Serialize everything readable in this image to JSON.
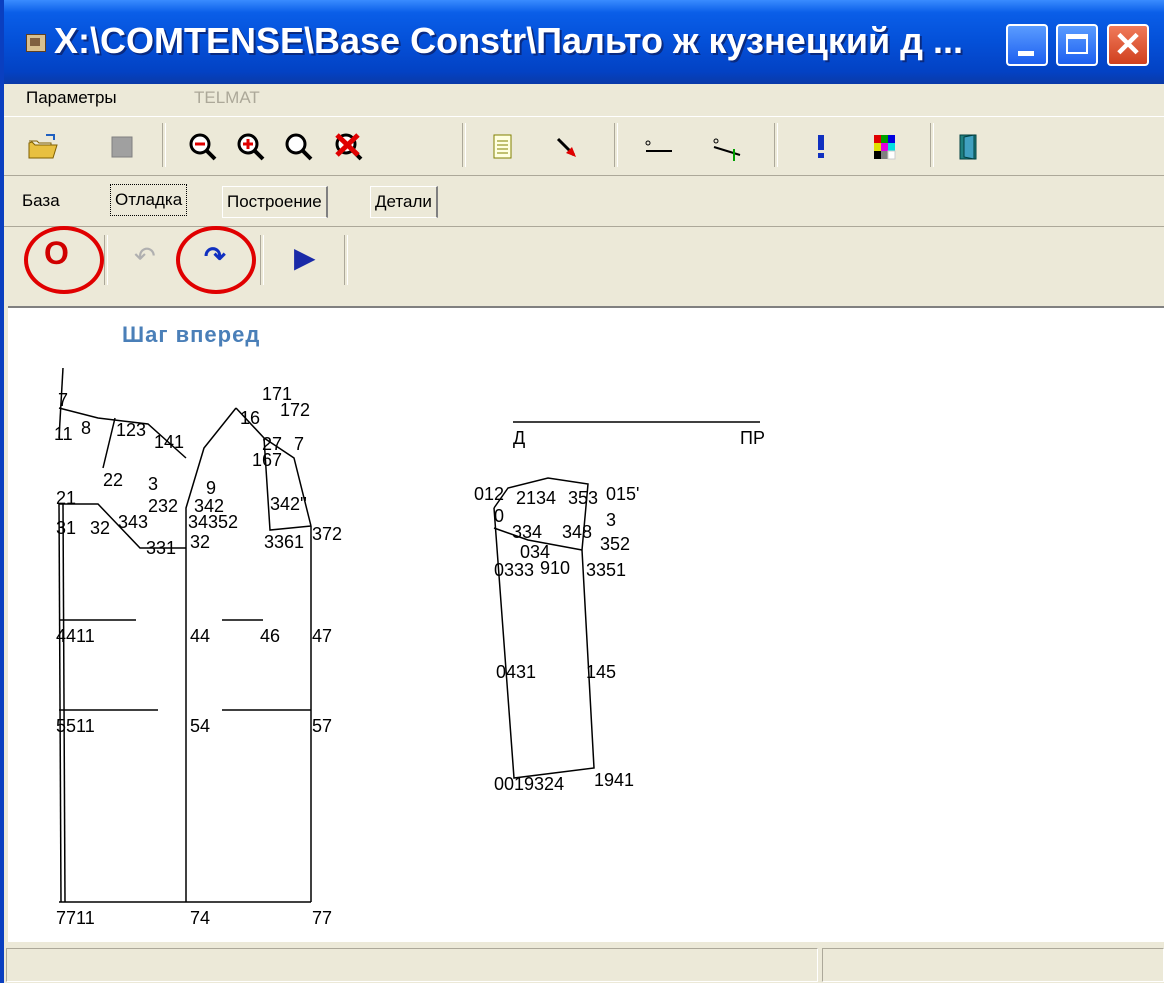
{
  "window": {
    "title": "X:\\COMTENSE\\Base Constr\\Пальто ж кузнецкий д ...",
    "minimize_glyph": "_",
    "maximize_glyph": "□",
    "close_glyph": "✕"
  },
  "menu": {
    "items": [
      "Параметры",
      "TELMAT"
    ]
  },
  "toolbar": {
    "icons": [
      "open-folder-icon",
      "stop-icon",
      "zoom-out-icon",
      "zoom-in-icon",
      "zoom-icon",
      "zoom-cancel-icon",
      "document-icon",
      "pointer-icon",
      "measure-line-icon",
      "measure-angle-icon",
      "info-icon",
      "color-palette-icon",
      "exit-icon"
    ]
  },
  "tabs": [
    "База",
    "Отладка",
    "Построение",
    "Детали"
  ],
  "active_tab": "Отладка",
  "debug": {
    "reset_label": "O",
    "step_back_glyph": "↶",
    "step_forward_glyph": "↷",
    "run_glyph": "▶"
  },
  "caption": "Шаг вперед",
  "colors": {
    "title_bar": "#0450d8",
    "highlight_circle": "#e00000",
    "caption": "#4a7fb8"
  },
  "drawing": {
    "back_labels": [
      "7",
      "11",
      "8",
      "123",
      "141",
      "16",
      "171",
      "172",
      "27",
      "7",
      "167",
      "22",
      "3",
      "9",
      "21",
      "31",
      "32",
      "343",
      "232",
      "342",
      "342''",
      "34352",
      "3361",
      "372",
      "331",
      "32",
      "4411",
      "44",
      "46",
      "47",
      "5511",
      "54",
      "57",
      "7711",
      "74",
      "77"
    ],
    "line_labels": [
      "Д",
      "ПР"
    ],
    "sleeve_labels": [
      "012",
      "2134",
      "353",
      "015'",
      "0",
      "3",
      "334",
      "348",
      "352",
      "034",
      "0333",
      "910",
      "3351",
      "0431",
      "145",
      "0019324",
      "1941"
    ]
  }
}
